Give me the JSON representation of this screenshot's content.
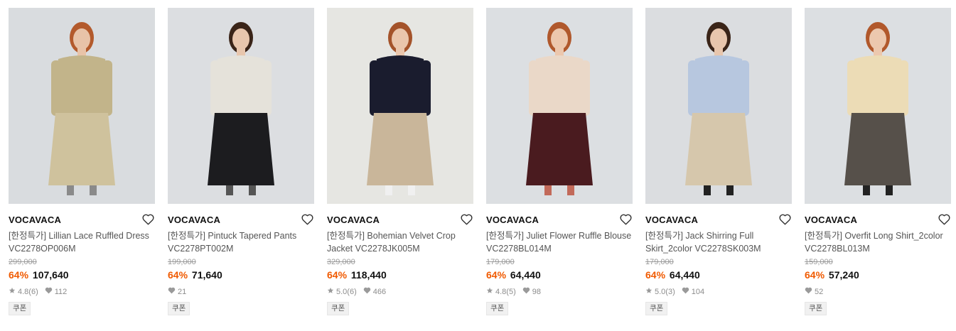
{
  "products": [
    {
      "brand": "VOCAVACA",
      "title": "[한정특가] Lillian Lace Ruffled Dress VC2278OP006M",
      "original_price": "299,000",
      "discount": "64%",
      "price": "107,640",
      "rating": "4.8",
      "review_count": "(6)",
      "likes": "112",
      "coupon": "쿠폰",
      "palette": {
        "bg": "#d9dcdf",
        "top": "#c2b48a",
        "bottom": "#cfc29d",
        "skin": "#e8c3a8",
        "hair": "#b35a2c",
        "accent": "#8a8a8a"
      }
    },
    {
      "brand": "VOCAVACA",
      "title": "[한정특가] Pintuck Tapered Pants VC2278PT002M",
      "original_price": "199,000",
      "discount": "64%",
      "price": "71,640",
      "rating": "",
      "review_count": "",
      "likes": "21",
      "coupon": "쿠폰",
      "palette": {
        "bg": "#dcdee1",
        "top": "#e5e2da",
        "bottom": "#1c1c1f",
        "skin": "#e8c6ad",
        "hair": "#3a2418",
        "accent": "#555"
      }
    },
    {
      "brand": "VOCAVACA",
      "title": "[한정특가] Bohemian Velvet Crop Jacket VC2278JK005M",
      "original_price": "329,000",
      "discount": "64%",
      "price": "118,440",
      "rating": "5.0",
      "review_count": "(6)",
      "likes": "466",
      "coupon": "쿠폰",
      "palette": {
        "bg": "#e6e6e2",
        "top": "#1a1c2e",
        "bottom": "#c9b69a",
        "skin": "#eac6ac",
        "hair": "#a4532a",
        "accent": "#f0f0f0"
      }
    },
    {
      "brand": "VOCAVACA",
      "title": "[한정특가] Juliet Flower Ruffle Blouse VC2278BL014M",
      "original_price": "179,000",
      "discount": "64%",
      "price": "64,440",
      "rating": "4.8",
      "review_count": "(5)",
      "likes": "98",
      "coupon": "쿠폰",
      "palette": {
        "bg": "#dcdfe2",
        "top": "#ead8c8",
        "bottom": "#4a1b1f",
        "skin": "#ecc7ad",
        "hair": "#b0582c",
        "accent": "#c26a5a"
      }
    },
    {
      "brand": "VOCAVACA",
      "title": "[한정특가] Jack Shirring Full Skirt_2color VC2278SK003M",
      "original_price": "179,000",
      "discount": "64%",
      "price": "64,440",
      "rating": "5.0",
      "review_count": "(3)",
      "likes": "104",
      "coupon": "쿠폰",
      "palette": {
        "bg": "#dbdde0",
        "top": "#b7c7df",
        "bottom": "#d6c7ac",
        "skin": "#e8c6ad",
        "hair": "#3a2418",
        "accent": "#222"
      }
    },
    {
      "brand": "VOCAVACA",
      "title": "[한정특가] Overfit Long Shirt_2color VC2278BL013M",
      "original_price": "159,000",
      "discount": "64%",
      "price": "57,240",
      "rating": "",
      "review_count": "",
      "likes": "52",
      "coupon": "쿠폰",
      "palette": {
        "bg": "#dcdfe2",
        "top": "#ecdcb6",
        "bottom": "#56504a",
        "skin": "#ecc8ae",
        "hair": "#b1582b",
        "accent": "#222"
      }
    }
  ]
}
